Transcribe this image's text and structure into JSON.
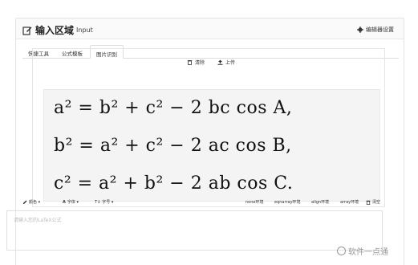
{
  "header": {
    "title": "输入区域",
    "subtitle": "Input",
    "settings_label": "编辑器设置"
  },
  "tabs": [
    {
      "label": "快捷工具",
      "active": false
    },
    {
      "label": "公式模板",
      "active": false
    },
    {
      "label": "图片识别",
      "active": true
    }
  ],
  "image_tab": {
    "clear_label": "清除",
    "upload_label": "上传",
    "equations": [
      "a² = b² + c² − 2 bc cos A,",
      "b² = a² + c² − 2 ac cos B,",
      "c² = a² + b² − 2 ab cos C."
    ]
  },
  "editor_toolbar": {
    "color_label": "颜色",
    "font_label": "字体",
    "size_label": "字号",
    "env_none": "none环境",
    "env_eqnarray": "eqnarray环境",
    "env_align": "align环境",
    "env_array": "array环境",
    "clear_label": "清空"
  },
  "editor": {
    "placeholder": "请输入您的LaTeX公式"
  },
  "watermark": {
    "text": "软件一点通"
  },
  "colors": {
    "border": "#e3e3e3",
    "text": "#333333"
  }
}
